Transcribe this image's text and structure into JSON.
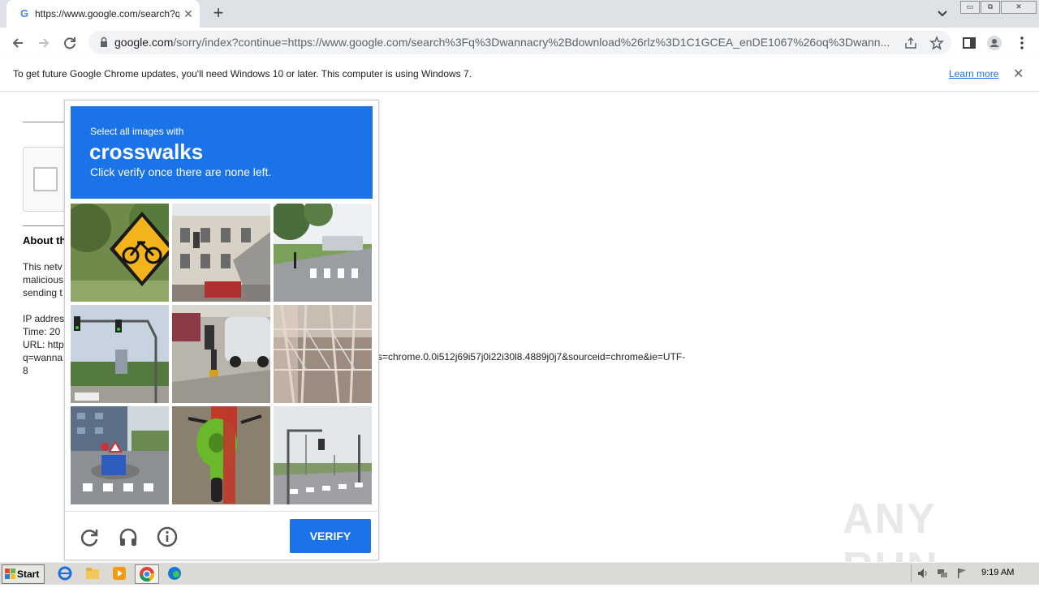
{
  "browser": {
    "tab_title": "https://www.google.com/search?q=",
    "tab_favicon": "G",
    "tab_close": "✕",
    "new_tab": "+",
    "url_host": "google.com",
    "url_rest": "/sorry/index?continue=https://www.google.com/search%3Fq%3Dwannacry%2Bdownload%26rlz%3D1C1GCEA_enDE1067%26oq%3Dwann..."
  },
  "infobar": {
    "message": "To get future Google Chrome updates, you'll need Windows 10 or later. This computer is using Windows 7.",
    "link": "Learn more",
    "close": "✕"
  },
  "page": {
    "about_heading": "About th",
    "lines": [
      "This netv",
      "malicious",
      "sending t",
      "IP addres",
      "Time: 20",
      "URL: http",
      "q=wanna",
      "8"
    ],
    "url_tail": "s=chrome.0.0i512j69i57j0i22i30l8.4889j0j7&sourceid=chrome&ie=UTF-"
  },
  "captcha": {
    "instruction": "Select all images with",
    "target": "crosswalks",
    "hint": "Click verify once there are none left.",
    "verify_label": "VERIFY",
    "tiles": [
      "bicycle-sign",
      "building-traffic-light",
      "crosswalk-park",
      "traffic-lights",
      "parked-cars",
      "power-lines",
      "roundabout-crosswalk",
      "green-scooter",
      "road-crosswalk"
    ]
  },
  "watermark": "ANY RUN",
  "taskbar": {
    "start": "Start",
    "clock": "9:19 AM"
  },
  "colors": {
    "accent": "#1a73e8",
    "tabstrip": "#dee1e6",
    "taskbar": "#dcdad5"
  }
}
